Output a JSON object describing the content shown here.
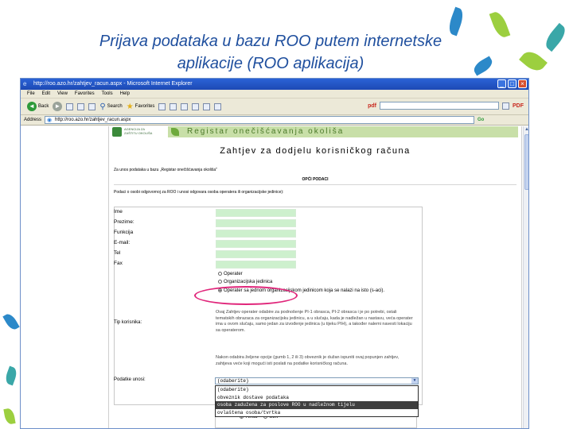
{
  "slide": {
    "title_line1": "Prijava podataka u bazu ROO putem internetske",
    "title_line2": "aplikacije (ROO aplikacija)"
  },
  "browser": {
    "window_title": "http://roo.azo.hr/zahtjev_racun.aspx - Microsoft Internet Explorer",
    "menu": [
      "File",
      "Edit",
      "View",
      "Favorites",
      "Tools",
      "Help"
    ],
    "toolbar": {
      "back": "Back",
      "search": "Search",
      "favorites": "Favorites"
    },
    "address_label": "Address",
    "address_url": "http://roo.azo.hr/zahtjev_racun.aspx",
    "go": "Go",
    "pdf_right": "PDF"
  },
  "page": {
    "logo_text": "AGENCIJA ZA ZAŠTITU OKOLIŠA",
    "banner": "Registar onečišćavanja okoliša",
    "heading": "Zahtjev za dodjelu korisničkog računa",
    "intro": "Za unos podataka u bazu „Registar onečišćavanja okoliša\"",
    "section_title": "OPĆI PODACI",
    "instructions": "Podaci o osobi odgovornoj za ROO i unosi odgovara osoba operatera ili organizacijske jedinice):",
    "fields": [
      {
        "label": "Ime"
      },
      {
        "label": "Prezime:"
      },
      {
        "label": "Funkcija"
      },
      {
        "label": "E-mail:"
      },
      {
        "label": "Tel"
      },
      {
        "label": "Fax"
      }
    ],
    "radio_options": [
      {
        "label": "Operater",
        "checked": false
      },
      {
        "label": "Organizacijska jedinica",
        "checked": false
      },
      {
        "label": "Operater sa jednom organizacijskom jedinicom koja se nalazi na isto (s-aci).",
        "checked": true
      }
    ],
    "user_type_label": "Tip korisnika:",
    "description": "Ovaj Zahtjev operater odabire za podnošenje PI-1 obrasca, PI-2 obrasca i je po potrebi, ostali tematskih obrazaca za organizacijsku jedinicu, a u slučaju, kada je nadležan u nastavu, veća operater ima u ovom slučaju, samo jedan za izvođenje jedinica (u tijeku PIH), a također nalemi navesti lokaciju sa operaterom.",
    "description2": "Nakon odabira željene opcije (gumb 1, 2 ili 3) obveznik je dužan ispuniti ovaj popunjen zahtjev, zahtjeva veće koji mogući isti poslati na podatke korisničkog računa.",
    "entry_label": "Podatke unosi:",
    "select_value": "(odaberite)",
    "dropdown_options": [
      {
        "label": "(odaberite)",
        "selected": false
      },
      {
        "label": "obveznik dostave podataka",
        "selected": false
      },
      {
        "label": "osoba zadužena za poslove ROO u nadležnom tijelu",
        "selected": true
      },
      {
        "label": "ovlaštena osoba/tvrtka",
        "selected": false
      }
    ],
    "bottom_radios": [
      "Tvrtka",
      "Obrt"
    ]
  }
}
